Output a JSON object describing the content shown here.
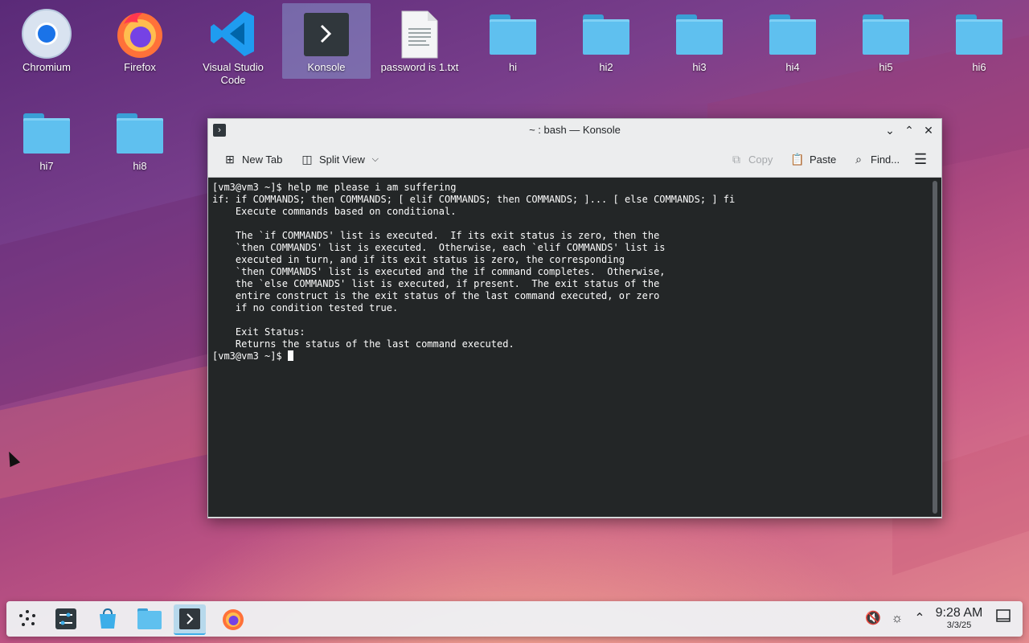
{
  "desktop": {
    "icons": [
      {
        "label": "Chromium",
        "icon": "chromium-icon"
      },
      {
        "label": "Firefox",
        "icon": "firefox-icon"
      },
      {
        "label": "Visual Studio Code",
        "icon": "vscode-icon"
      },
      {
        "label": "Konsole",
        "icon": "konsole-icon"
      },
      {
        "label": "password is 1.txt",
        "icon": "text-file-icon"
      },
      {
        "label": "hi",
        "icon": "folder-icon"
      },
      {
        "label": "hi2",
        "icon": "folder-icon"
      },
      {
        "label": "hi3",
        "icon": "folder-icon"
      },
      {
        "label": "hi4",
        "icon": "folder-icon"
      },
      {
        "label": "hi5",
        "icon": "folder-icon"
      },
      {
        "label": "hi6",
        "icon": "folder-icon"
      },
      {
        "label": "hi7",
        "icon": "folder-icon"
      },
      {
        "label": "hi8",
        "icon": "folder-icon"
      }
    ]
  },
  "window": {
    "title": "~ : bash — Konsole",
    "toolbar": {
      "new_tab": "New Tab",
      "split_view": "Split View",
      "copy": "Copy",
      "paste": "Paste",
      "find": "Find..."
    },
    "terminal_lines": [
      "[vm3@vm3 ~]$ help me please i am suffering",
      "if: if COMMANDS; then COMMANDS; [ elif COMMANDS; then COMMANDS; ]... [ else COMMANDS; ] fi",
      "    Execute commands based on conditional.",
      "",
      "    The `if COMMANDS' list is executed.  If its exit status is zero, then the",
      "    `then COMMANDS' list is executed.  Otherwise, each `elif COMMANDS' list is",
      "    executed in turn, and if its exit status is zero, the corresponding",
      "    `then COMMANDS' list is executed and the if command completes.  Otherwise,",
      "    the `else COMMANDS' list is executed, if present.  The exit status of the",
      "    entire construct is the exit status of the last command executed, or zero",
      "    if no condition tested true.",
      "",
      "    Exit Status:",
      "    Returns the status of the last command executed."
    ],
    "prompt": "[vm3@vm3 ~]$ "
  },
  "taskbar": {
    "items": [
      "application-launcher-icon",
      "system-settings-icon",
      "discover-store-icon",
      "dolphin-folder-icon",
      "konsole-icon",
      "firefox-icon"
    ],
    "clock": {
      "time": "9:28 AM",
      "date": "3/3/25"
    }
  },
  "colors": {
    "accent": "#3daee9",
    "terminal_bg": "#232627",
    "terminal_fg": "#fcfcfc",
    "folder": "#5fc0ef"
  }
}
